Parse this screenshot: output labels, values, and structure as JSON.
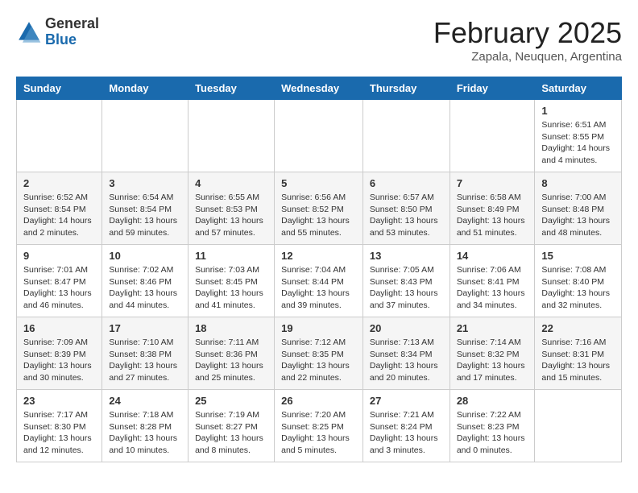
{
  "header": {
    "logo_general": "General",
    "logo_blue": "Blue",
    "month_title": "February 2025",
    "location": "Zapala, Neuquen, Argentina"
  },
  "days_of_week": [
    "Sunday",
    "Monday",
    "Tuesday",
    "Wednesday",
    "Thursday",
    "Friday",
    "Saturday"
  ],
  "weeks": [
    [
      {
        "day": "",
        "info": ""
      },
      {
        "day": "",
        "info": ""
      },
      {
        "day": "",
        "info": ""
      },
      {
        "day": "",
        "info": ""
      },
      {
        "day": "",
        "info": ""
      },
      {
        "day": "",
        "info": ""
      },
      {
        "day": "1",
        "info": "Sunrise: 6:51 AM\nSunset: 8:55 PM\nDaylight: 14 hours and 4 minutes."
      }
    ],
    [
      {
        "day": "2",
        "info": "Sunrise: 6:52 AM\nSunset: 8:54 PM\nDaylight: 14 hours and 2 minutes."
      },
      {
        "day": "3",
        "info": "Sunrise: 6:54 AM\nSunset: 8:54 PM\nDaylight: 13 hours and 59 minutes."
      },
      {
        "day": "4",
        "info": "Sunrise: 6:55 AM\nSunset: 8:53 PM\nDaylight: 13 hours and 57 minutes."
      },
      {
        "day": "5",
        "info": "Sunrise: 6:56 AM\nSunset: 8:52 PM\nDaylight: 13 hours and 55 minutes."
      },
      {
        "day": "6",
        "info": "Sunrise: 6:57 AM\nSunset: 8:50 PM\nDaylight: 13 hours and 53 minutes."
      },
      {
        "day": "7",
        "info": "Sunrise: 6:58 AM\nSunset: 8:49 PM\nDaylight: 13 hours and 51 minutes."
      },
      {
        "day": "8",
        "info": "Sunrise: 7:00 AM\nSunset: 8:48 PM\nDaylight: 13 hours and 48 minutes."
      }
    ],
    [
      {
        "day": "9",
        "info": "Sunrise: 7:01 AM\nSunset: 8:47 PM\nDaylight: 13 hours and 46 minutes."
      },
      {
        "day": "10",
        "info": "Sunrise: 7:02 AM\nSunset: 8:46 PM\nDaylight: 13 hours and 44 minutes."
      },
      {
        "day": "11",
        "info": "Sunrise: 7:03 AM\nSunset: 8:45 PM\nDaylight: 13 hours and 41 minutes."
      },
      {
        "day": "12",
        "info": "Sunrise: 7:04 AM\nSunset: 8:44 PM\nDaylight: 13 hours and 39 minutes."
      },
      {
        "day": "13",
        "info": "Sunrise: 7:05 AM\nSunset: 8:43 PM\nDaylight: 13 hours and 37 minutes."
      },
      {
        "day": "14",
        "info": "Sunrise: 7:06 AM\nSunset: 8:41 PM\nDaylight: 13 hours and 34 minutes."
      },
      {
        "day": "15",
        "info": "Sunrise: 7:08 AM\nSunset: 8:40 PM\nDaylight: 13 hours and 32 minutes."
      }
    ],
    [
      {
        "day": "16",
        "info": "Sunrise: 7:09 AM\nSunset: 8:39 PM\nDaylight: 13 hours and 30 minutes."
      },
      {
        "day": "17",
        "info": "Sunrise: 7:10 AM\nSunset: 8:38 PM\nDaylight: 13 hours and 27 minutes."
      },
      {
        "day": "18",
        "info": "Sunrise: 7:11 AM\nSunset: 8:36 PM\nDaylight: 13 hours and 25 minutes."
      },
      {
        "day": "19",
        "info": "Sunrise: 7:12 AM\nSunset: 8:35 PM\nDaylight: 13 hours and 22 minutes."
      },
      {
        "day": "20",
        "info": "Sunrise: 7:13 AM\nSunset: 8:34 PM\nDaylight: 13 hours and 20 minutes."
      },
      {
        "day": "21",
        "info": "Sunrise: 7:14 AM\nSunset: 8:32 PM\nDaylight: 13 hours and 17 minutes."
      },
      {
        "day": "22",
        "info": "Sunrise: 7:16 AM\nSunset: 8:31 PM\nDaylight: 13 hours and 15 minutes."
      }
    ],
    [
      {
        "day": "23",
        "info": "Sunrise: 7:17 AM\nSunset: 8:30 PM\nDaylight: 13 hours and 12 minutes."
      },
      {
        "day": "24",
        "info": "Sunrise: 7:18 AM\nSunset: 8:28 PM\nDaylight: 13 hours and 10 minutes."
      },
      {
        "day": "25",
        "info": "Sunrise: 7:19 AM\nSunset: 8:27 PM\nDaylight: 13 hours and 8 minutes."
      },
      {
        "day": "26",
        "info": "Sunrise: 7:20 AM\nSunset: 8:25 PM\nDaylight: 13 hours and 5 minutes."
      },
      {
        "day": "27",
        "info": "Sunrise: 7:21 AM\nSunset: 8:24 PM\nDaylight: 13 hours and 3 minutes."
      },
      {
        "day": "28",
        "info": "Sunrise: 7:22 AM\nSunset: 8:23 PM\nDaylight: 13 hours and 0 minutes."
      },
      {
        "day": "",
        "info": ""
      }
    ]
  ]
}
